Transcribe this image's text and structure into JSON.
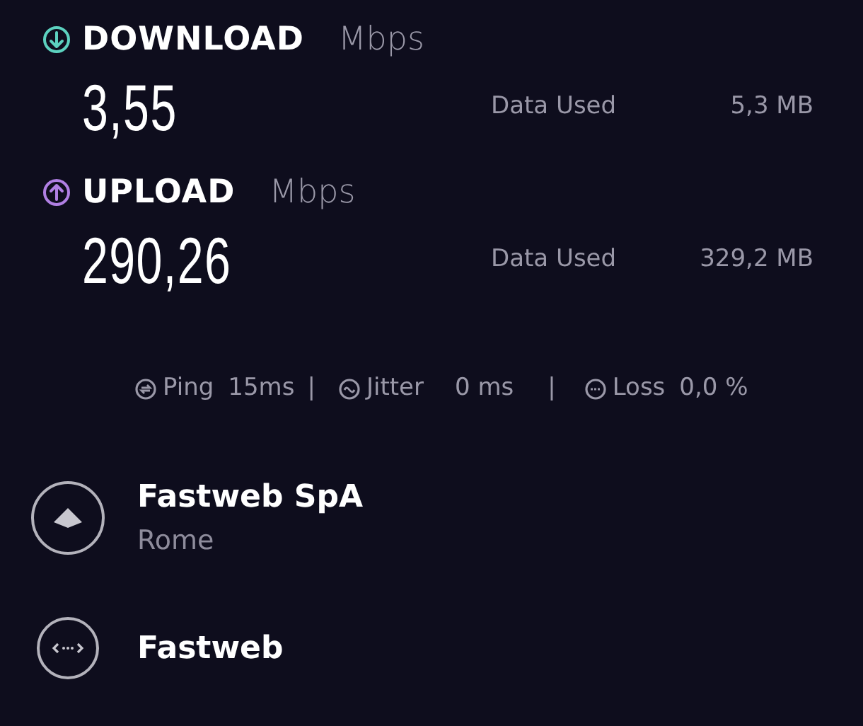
{
  "results": [
    {
      "kind": "download",
      "label": "DOWNLOAD",
      "unit": "Mbps",
      "value": "3,55",
      "data_used_label": "Data Used",
      "data_used": "5,3 MB"
    },
    {
      "kind": "upload",
      "label": "UPLOAD",
      "unit": "Mbps",
      "value": "290,26",
      "data_used_label": "Data Used",
      "data_used": "329,2 MB"
    }
  ],
  "metrics": [
    {
      "kind": "ping",
      "label": "Ping",
      "value": "15ms",
      "separator": "|"
    },
    {
      "kind": "jitter",
      "label": "Jitter",
      "value": "0 ms",
      "separator": "|"
    },
    {
      "kind": "loss",
      "label": "Loss",
      "value": "0,0 %"
    }
  ],
  "connection": [
    {
      "kind": "server",
      "name": "Fastweb SpA",
      "location": "Rome"
    },
    {
      "kind": "provider",
      "name": "Fastweb"
    }
  ]
}
